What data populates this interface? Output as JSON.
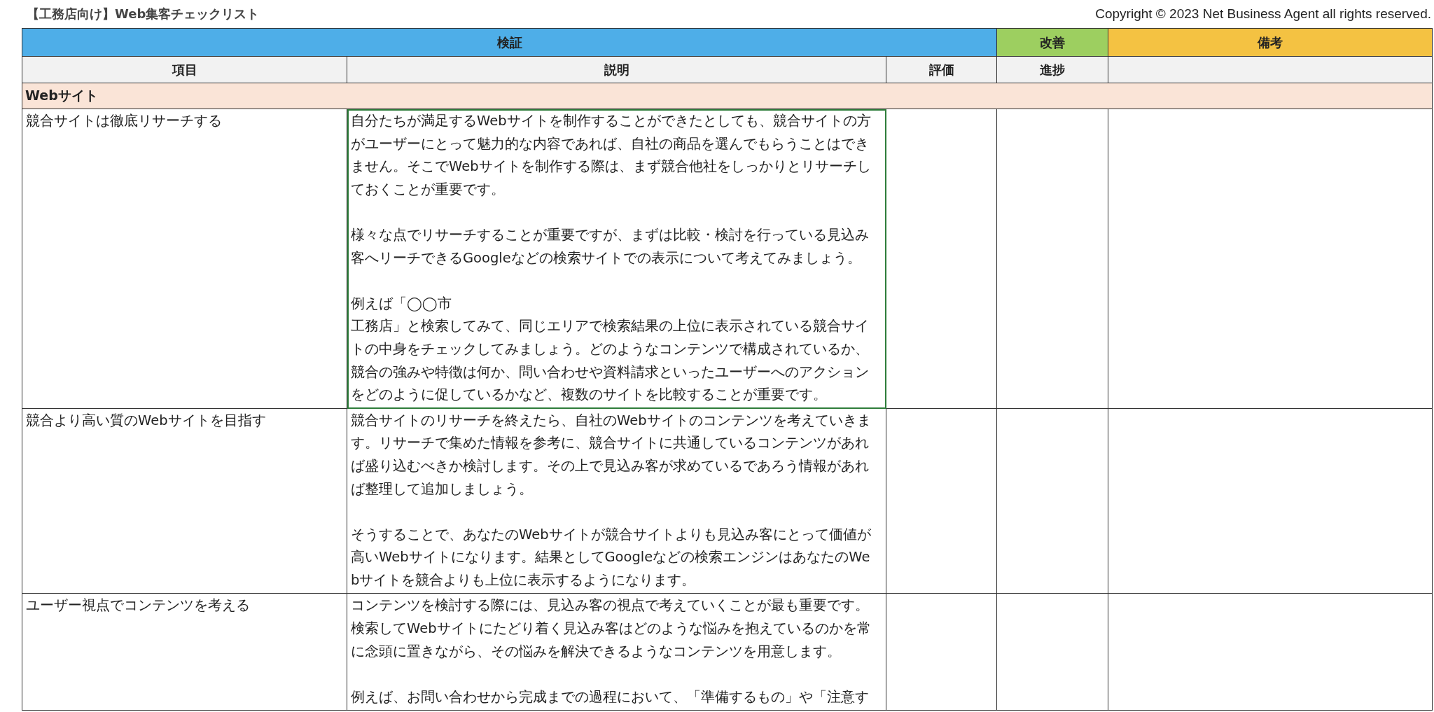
{
  "title": "【工務店向け】Web集客チェックリスト",
  "copyright": "Copyright © 2023 Net Business Agent all rights reserved.",
  "header_groups": [
    {
      "label": "検証",
      "color": "#4eaee8",
      "columns": [
        "項目",
        "説明",
        "評価"
      ]
    },
    {
      "label": "改善",
      "color": "#9dcf60",
      "columns": [
        "進捗"
      ]
    },
    {
      "label": "備考",
      "color": "#f4c242"
    }
  ],
  "section": {
    "label": "Webサイト"
  },
  "rows": [
    {
      "item": "競合サイトは徹底リサーチする",
      "selected": true,
      "description": [
        [
          "自分たちが満足するWebサイトを制作することができたとしても、競合サイトの方",
          "がユーザーにとって魅力的な内容であれば、自社の商品を選んでもらうことはでき",
          "ません。そこでWebサイトを制作する際は、まず競合他社をしっかりとリサーチし",
          "ておくことが重要です。"
        ],
        [
          "様々な点でリサーチすることが重要ですが、まずは比較・検討を行っている見込み",
          "客へリーチできるGoogleなどの検索サイトでの表示について考えてみましょう。"
        ],
        [
          "例えば「◯◯市",
          "工務店」と検索してみて、同じエリアで検索結果の上位に表示されている競合サイ",
          "トの中身をチェックしてみましょう。どのようなコンテンツで構成されているか、",
          "競合の強みや特徴は何か、問い合わせや資料請求といったユーザーへのアクション",
          "をどのように促しているかなど、複数のサイトを比較することが重要です。"
        ]
      ]
    },
    {
      "item": "競合より高い質のWebサイトを目指す",
      "selected": false,
      "description": [
        [
          "競合サイトのリサーチを終えたら、自社のWebサイトのコンテンツを考えていきま",
          "す。リサーチで集めた情報を参考に、競合サイトに共通しているコンテンツがあれ",
          "ば盛り込むべきか検討します。その上で見込み客が求めているであろう情報があれ",
          "ば整理して追加しましょう。"
        ],
        [
          "そうすることで、あなたのWebサイトが競合サイトよりも見込み客にとって価値が",
          "高いWebサイトになります。結果としてGoogleなどの検索エンジンはあなたのWe",
          "bサイトを競合よりも上位に表示するようになります。"
        ]
      ]
    },
    {
      "item": "ユーザー視点でコンテンツを考える",
      "selected": false,
      "description": [
        [
          "コンテンツを検討する際には、見込み客の視点で考えていくことが最も重要です。",
          "検索してWebサイトにたどり着く見込み客はどのような悩みを抱えているのかを常",
          "に念頭に置きながら、その悩みを解決できるようなコンテンツを用意します。"
        ],
        [
          "例えば、お問い合わせから完成までの過程において、「準備するもの」や「注意す"
        ]
      ]
    }
  ]
}
